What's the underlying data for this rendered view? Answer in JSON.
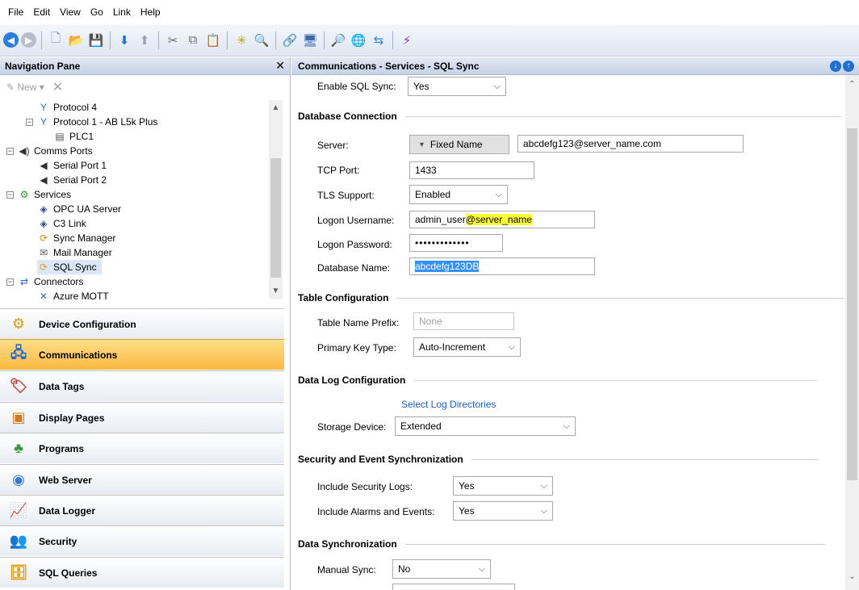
{
  "menu": [
    "File",
    "Edit",
    "View",
    "Go",
    "Link",
    "Help"
  ],
  "nav": {
    "title": "Navigation Pane",
    "close": "✕",
    "new_label": "New",
    "tree": [
      {
        "label": "Protocol 4"
      },
      {
        "label": "Protocol 1 - AB L5k Plus"
      },
      {
        "label": "PLC1"
      },
      {
        "label": "Comms Ports"
      },
      {
        "label": "Serial Port 1"
      },
      {
        "label": "Serial Port 2"
      },
      {
        "label": "Services"
      },
      {
        "label": "OPC UA Server"
      },
      {
        "label": "C3 Link"
      },
      {
        "label": "Sync Manager"
      },
      {
        "label": "Mail Manager"
      },
      {
        "label": "SQL Sync"
      },
      {
        "label": "Connectors"
      },
      {
        "label": "Azure MQTT"
      }
    ],
    "buttons": [
      {
        "label": "Device Configuration"
      },
      {
        "label": "Communications"
      },
      {
        "label": "Data Tags"
      },
      {
        "label": "Display Pages"
      },
      {
        "label": "Programs"
      },
      {
        "label": "Web Server"
      },
      {
        "label": "Data Logger"
      },
      {
        "label": "Security"
      },
      {
        "label": "SQL Queries"
      }
    ]
  },
  "content": {
    "title": "Communications - Services - SQL Sync",
    "enable_sql_sync": {
      "label": "Enable SQL Sync:",
      "value": "Yes"
    },
    "db_section": "Database Connection",
    "server": {
      "label": "Server:",
      "button": "Fixed Name",
      "value": "abcdefg123@server_name.com"
    },
    "tcp_port": {
      "label": "TCP Port:",
      "value": "1433"
    },
    "tls": {
      "label": "TLS Support:",
      "value": "Enabled"
    },
    "username": {
      "label": "Logon Username:",
      "value_a": "admin_user",
      "value_b": "@server_name"
    },
    "password": {
      "label": "Logon Password:",
      "value": "•••••••••••••"
    },
    "dbname": {
      "label": "Database Name:",
      "value": "abcdefg123DB"
    },
    "table_section": "Table Configuration",
    "prefix": {
      "label": "Table Name Prefix:",
      "placeholder": "None"
    },
    "pk": {
      "label": "Primary Key Type:",
      "value": "Auto-Increment"
    },
    "log_section": "Data Log Configuration",
    "select_log": "Select Log Directories",
    "storage": {
      "label": "Storage Device:",
      "value": "Extended"
    },
    "sec_section": "Security and Event Synchronization",
    "sec_logs": {
      "label": "Include Security Logs:",
      "value": "Yes"
    },
    "alarms": {
      "label": "Include Alarms and Events:",
      "value": "Yes"
    },
    "sync_section": "Data Synchronization",
    "manual": {
      "label": "Manual Sync:",
      "value": "No"
    }
  },
  "colors": {
    "active_tab": "#f9b942",
    "header": "#c6d2e6",
    "accent_blue": "#1f6fd1",
    "highlight": "#ffff33"
  }
}
